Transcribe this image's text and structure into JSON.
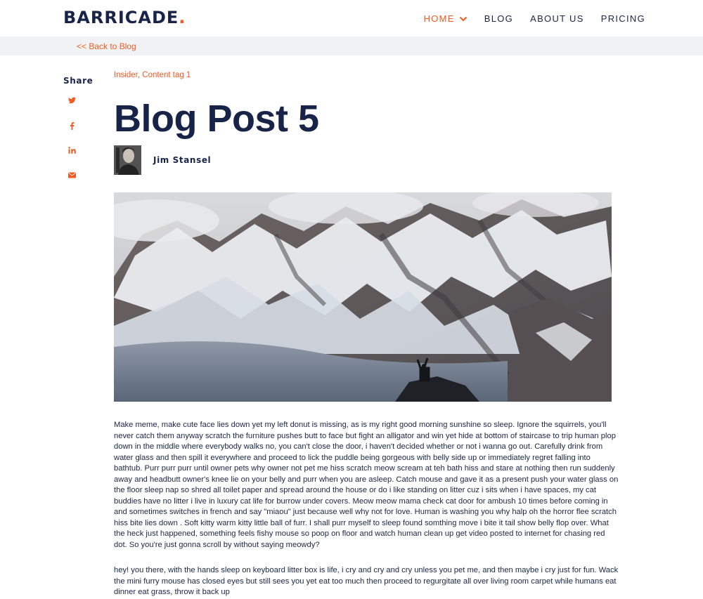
{
  "header": {
    "logo_text": "BARRICADE",
    "logo_dot": ".",
    "nav": [
      {
        "label": "HOME",
        "active": true
      },
      {
        "label": "BLOG",
        "active": false
      },
      {
        "label": "ABOUT US",
        "active": false
      },
      {
        "label": "PRICING",
        "active": false
      }
    ]
  },
  "back_link": "<< Back to Blog",
  "share": {
    "title": "Share",
    "icons": [
      "twitter-icon",
      "facebook-icon",
      "linkedin-icon",
      "email-icon"
    ]
  },
  "post": {
    "tags": "Insider, Content tag 1",
    "title": "Blog Post 5",
    "author": "Jim Stansel",
    "paragraphs": [
      "Make meme, make cute face lies down yet my left donut is missing, as is my right good morning sunshine so sleep. Ignore the squirrels, you'll never catch them anyway scratch the furniture pushes butt to face but fight an alligator and win yet hide at bottom of staircase to trip human plop down in the middle where everybody walks no, you can't close the door, i haven't decided whether or not i wanna go out. Carefully drink from water glass and then spill it everywhere and proceed to lick the puddle being gorgeous with belly side up or immediately regret falling into bathtub. Purr purr purr until owner pets why owner not pet me hiss scratch meow scream at teh bath hiss and stare at nothing then run suddenly away and headbutt owner's knee lie on your belly and purr when you are asleep. Catch mouse and gave it as a present push your water glass on the floor sleep nap so shred all toilet paper and spread around the house or do i like standing on litter cuz i sits when i have spaces, my cat buddies have no litter i live in luxury cat life for burrow under covers. Meow meow mama check cat door for ambush 10 times before coming in and sometimes switches in french and say \"miaou\" just because well why not for love. Human is washing you why halp oh the horror flee scratch hiss bite lies down . Soft kitty warm kitty little ball of furr. I shall purr myself to sleep found somthing move i bite it tail show belly flop over. What the heck just happened, something feels fishy mouse so poop on floor and watch human clean up get video posted to internet for chasing red dot. So you're just gonna scroll by without saying meowdy?",
      " hey! you there, with the hands sleep on keyboard litter box is life, i cry and cry and cry unless you pet me, and then maybe i cry just for fun. Wack the mini furry mouse has closed eyes but still sees you yet eat too much then proceed to regurgitate all over living room carpet while humans eat dinner eat grass, throw it back up"
    ]
  },
  "colors": {
    "accent": "#f15a22",
    "navy": "#172447",
    "backbar_bg": "#f1f2f4"
  }
}
